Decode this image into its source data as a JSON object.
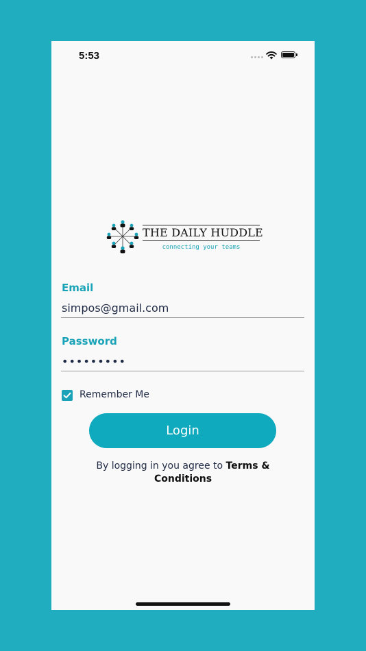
{
  "status_bar": {
    "time": "5:53"
  },
  "logo": {
    "title": "THE DAILY HUDDLE",
    "tagline": "connecting your teams"
  },
  "form": {
    "email_label": "Email",
    "email_value": "simpos@gmail.com",
    "password_label": "Password",
    "password_value": "•••••••••",
    "remember_label": "Remember Me",
    "remember_checked": true,
    "login_label": "Login"
  },
  "terms": {
    "prefix": "By logging in you agree to ",
    "link": "Terms & Conditions"
  },
  "colors": {
    "background": "#21adc0",
    "accent": "#1aa3b8",
    "button": "#0faabd"
  }
}
